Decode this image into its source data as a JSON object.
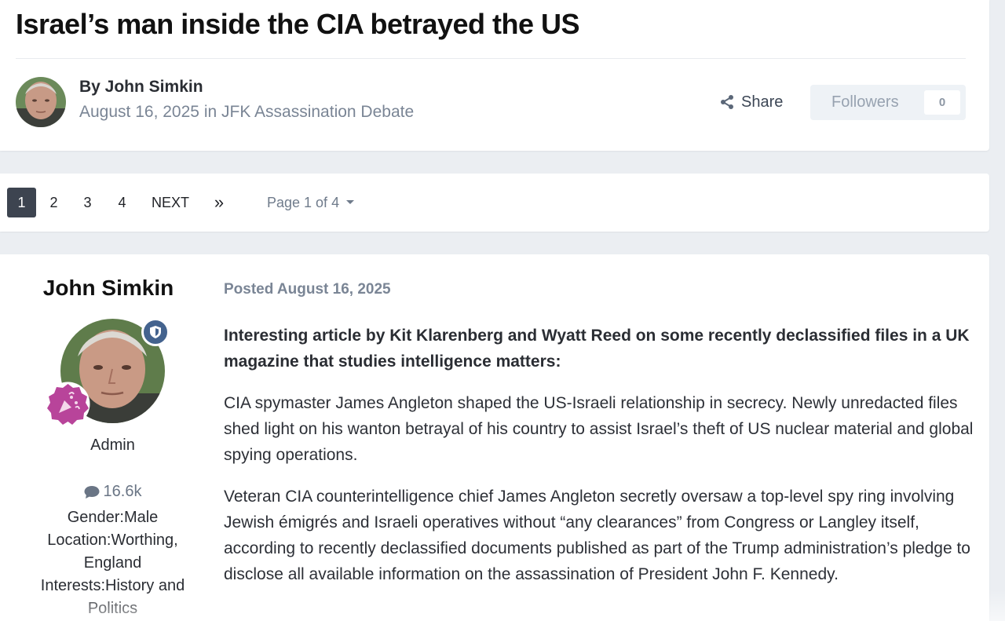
{
  "topic": {
    "title": "Israel’s man inside the CIA betrayed the US",
    "byline": "By John Simkin",
    "date": "August 16, 2025",
    "in_word": "in",
    "forum": "JFK Assassination Debate",
    "share_label": "Share",
    "followers_label": "Followers",
    "followers_count": "0"
  },
  "pagination": {
    "pages": [
      "1",
      "2",
      "3",
      "4"
    ],
    "active_page": "1",
    "next_label": "NEXT",
    "last_label": "»",
    "page_select_label": "Page 1 of 4"
  },
  "post": {
    "author_name": "John Simkin",
    "group": "Admin",
    "post_count": "16.6k",
    "gender": "Gender:Male",
    "location": "Location:Worthing, England",
    "interests": "Interests:History and Politics",
    "posted_label": "Posted August 16, 2025",
    "paragraphs": [
      "Interesting article by Kit Klarenberg and Wyatt Reed on some recently declassified files in a UK magazine that studies intelligence matters:",
      "CIA spymaster James Angleton shaped the US-Israeli relationship in secrecy. Newly unredacted files shed light on his wanton betrayal of his country to assist Israel’s theft of US nuclear material and global spying operations.",
      "Veteran CIA counterintelligence chief James Angleton secretly oversaw a top-level spy ring involving Jewish émigrés and Israeli operatives without “any clearances” from Congress or Langley itself, according to recently declassified documents published as part of the Trump administration’s pledge to disclose all available information on the assassination of President John F. Kennedy."
    ]
  },
  "colors": {
    "page_bg": "#ebeef2",
    "active_page_bg": "#3d4450",
    "moderator_badge": "#44638e",
    "rank_badge": "#b8449a",
    "meta_text": "#7a8595"
  },
  "icons": {
    "share": "share-icon",
    "comment": "comment-icon",
    "moderator": "shield-icon",
    "rank": "party-popper-icon",
    "dropdown": "caret-down-icon"
  }
}
